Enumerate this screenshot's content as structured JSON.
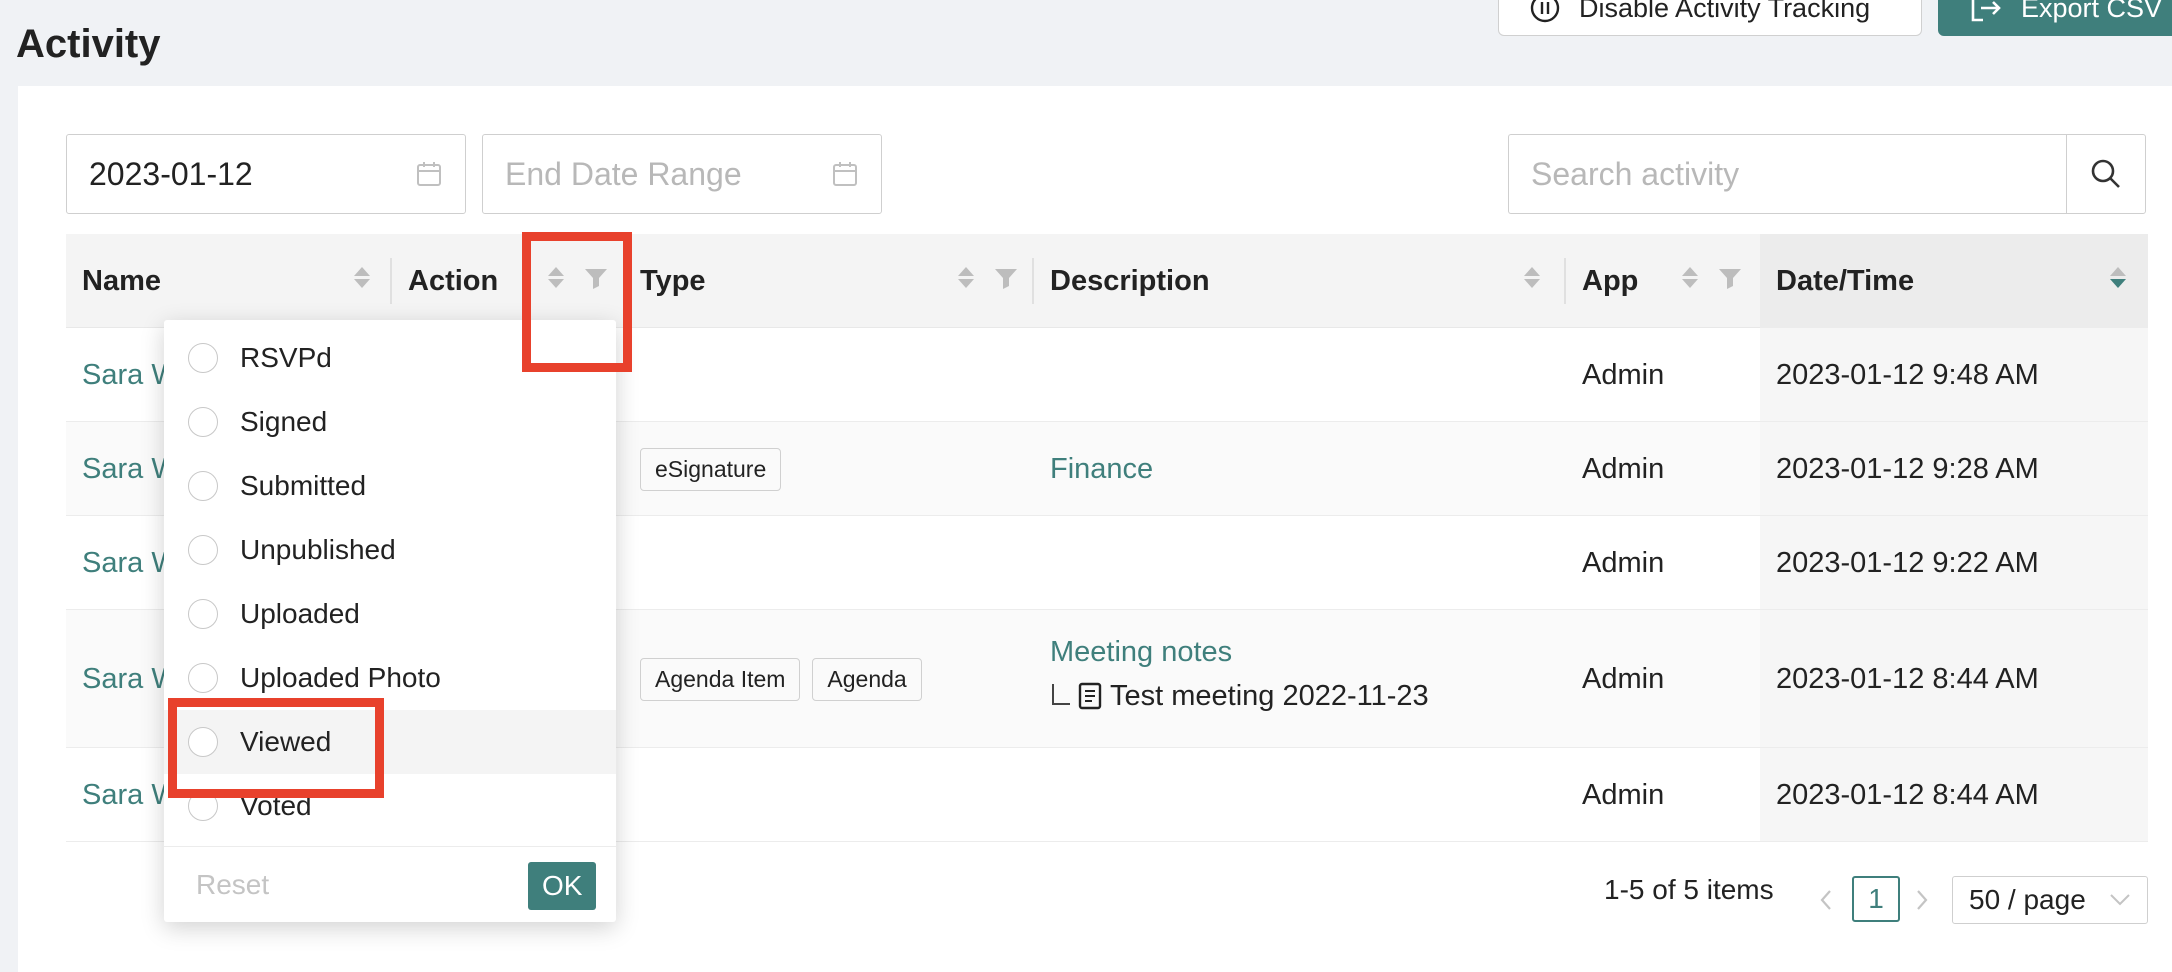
{
  "page": {
    "title": "Activity"
  },
  "toolbar": {
    "disable_tracking_label": "Disable Activity Tracking",
    "export_label": "Export CSV"
  },
  "filters": {
    "start_date_value": "2023-01-12",
    "end_date_placeholder": "End Date Range",
    "search_placeholder": "Search activity"
  },
  "table": {
    "columns": [
      "Name",
      "Action",
      "Type",
      "Description",
      "App",
      "Date/Time"
    ],
    "rows": [
      {
        "name": "Sara W",
        "type_tags": [],
        "description": "",
        "description_sub": "",
        "app": "Admin",
        "datetime": "2023-01-12 9:48 AM"
      },
      {
        "name": "Sara W",
        "type_tags": [
          "eSignature"
        ],
        "description": "Finance",
        "description_sub": "",
        "app": "Admin",
        "datetime": "2023-01-12 9:28 AM"
      },
      {
        "name": "Sara W",
        "type_tags": [],
        "description": "",
        "description_sub": "",
        "app": "Admin",
        "datetime": "2023-01-12 9:22 AM"
      },
      {
        "name": "Sara W",
        "type_tags": [
          "Agenda Item",
          "Agenda"
        ],
        "description": "Meeting notes",
        "description_sub": "Test meeting 2022-11-23",
        "app": "Admin",
        "datetime": "2023-01-12 8:44 AM"
      },
      {
        "name": "Sara W",
        "type_tags": [],
        "description": "",
        "description_sub": "",
        "app": "Admin",
        "datetime": "2023-01-12 8:44 AM"
      }
    ]
  },
  "action_filter": {
    "options": [
      "RSVPd",
      "Signed",
      "Submitted",
      "Unpublished",
      "Uploaded",
      "Uploaded Photo",
      "Viewed",
      "Voted"
    ],
    "highlighted_option": "Viewed",
    "reset_label": "Reset",
    "ok_label": "OK"
  },
  "pagination": {
    "summary": "1-5 of 5 items",
    "current_page": "1",
    "page_size": "50 / page",
    "prev_icon": "chevron-left-icon",
    "next_icon": "chevron-right-icon"
  },
  "colors": {
    "accent": "#3f7f7c",
    "highlight_box": "#e8412c"
  }
}
